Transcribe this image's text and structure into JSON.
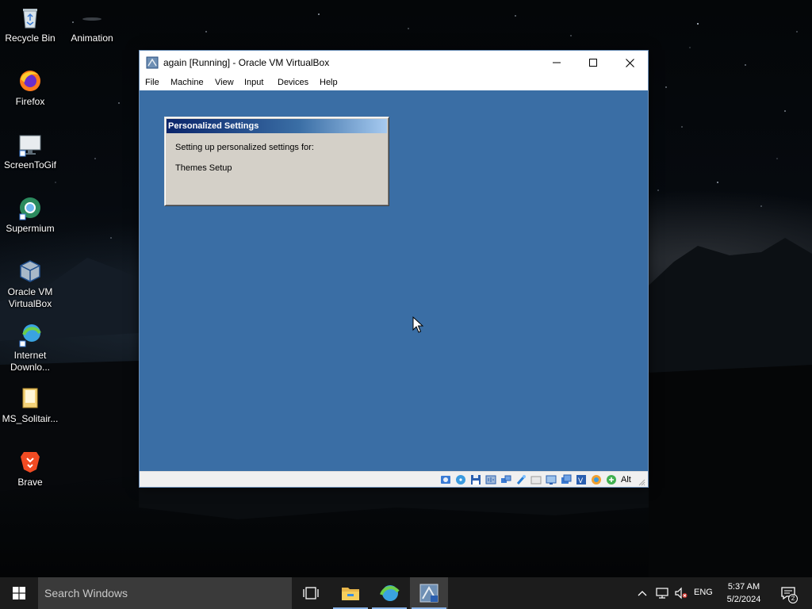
{
  "desktop": {
    "icons": [
      {
        "label": "Recycle Bin",
        "icon": "recycle-bin-icon"
      },
      {
        "label": "Animation",
        "icon": "animation-icon"
      },
      {
        "label": "Firefox",
        "icon": "firefox-icon"
      },
      {
        "label": "ScreenToGif",
        "icon": "screentogif-icon"
      },
      {
        "label": "Supermium",
        "icon": "supermium-icon"
      },
      {
        "label": "Oracle VM VirtualBox",
        "icon": "virtualbox-icon"
      },
      {
        "label": "Internet Downlo...",
        "icon": "internet-download-manager-icon"
      },
      {
        "label": "MS_Solitair...",
        "icon": "folder-icon"
      },
      {
        "label": "Brave",
        "icon": "brave-icon"
      }
    ]
  },
  "vbox_window": {
    "title": "again [Running] - Oracle VM VirtualBox",
    "menu": [
      "File",
      "Machine",
      "View",
      "Input",
      "Devices",
      "Help"
    ],
    "host_key": "Alt",
    "status_icons": [
      "hard-disk-icon",
      "optical-drive-icon",
      "floppy-icon",
      "audio-icon",
      "network-icon",
      "usb-icon",
      "shared-folders-icon",
      "display-icon",
      "video-capture-icon",
      "cpu-icon",
      "mouse-integration-icon",
      "keyboard-icon",
      "recording-icon"
    ]
  },
  "guest": {
    "dialog": {
      "title": "Personalized Settings",
      "line1": "Setting up personalized settings for:",
      "line2": "Themes Setup"
    }
  },
  "taskbar": {
    "search_placeholder": "Search Windows",
    "apps": [
      "task-view-icon",
      "file-explorer-icon",
      "internet-download-manager-icon",
      "virtualbox-xp-icon"
    ],
    "tray": {
      "language": "ENG",
      "time": "5:37 AM",
      "date": "5/2/2024",
      "notification_count": "2"
    }
  },
  "colors": {
    "guest_desktop": "#3a6ea5",
    "xp_title_start": "#0a246a",
    "xp_title_end": "#a6caf0",
    "taskbar": "#1c1c1c"
  }
}
